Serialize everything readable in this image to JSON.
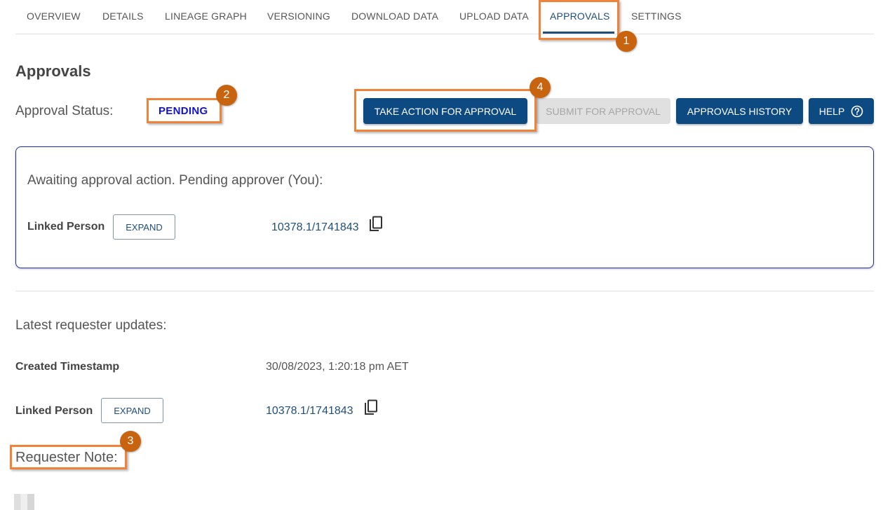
{
  "tabs": [
    {
      "label": "OVERVIEW"
    },
    {
      "label": "DETAILS"
    },
    {
      "label": "LINEAGE GRAPH"
    },
    {
      "label": "VERSIONING"
    },
    {
      "label": "DOWNLOAD DATA"
    },
    {
      "label": "UPLOAD DATA"
    },
    {
      "label": "APPROVALS"
    },
    {
      "label": "SETTINGS"
    }
  ],
  "active_tab": "APPROVALS",
  "page_title": "Approvals",
  "approval_status": {
    "label": "Approval Status:",
    "value": "PENDING"
  },
  "actions": {
    "take_action": "TAKE ACTION FOR APPROVAL",
    "submit": "SUBMIT FOR APPROVAL",
    "history": "APPROVALS HISTORY",
    "help": "HELP"
  },
  "card": {
    "heading": "Awaiting approval action. Pending approver (You):",
    "linked_person_label": "Linked Person",
    "expand_label": "EXPAND",
    "linked_person_id": "10378.1/1741843"
  },
  "requester": {
    "heading": "Latest requester updates:",
    "created_label": "Created Timestamp",
    "created_value": "30/08/2023, 1:20:18 pm AET",
    "linked_person_label": "Linked Person",
    "expand_label": "EXPAND",
    "linked_person_id": "10378.1/1741843",
    "note_label": "Requester Note:"
  },
  "annotations": [
    "1",
    "2",
    "3",
    "4"
  ],
  "colors": {
    "primary": "#0e4a82",
    "pending": "#1212d6",
    "highlight": "#f0833a",
    "badge": "#c8640f"
  }
}
